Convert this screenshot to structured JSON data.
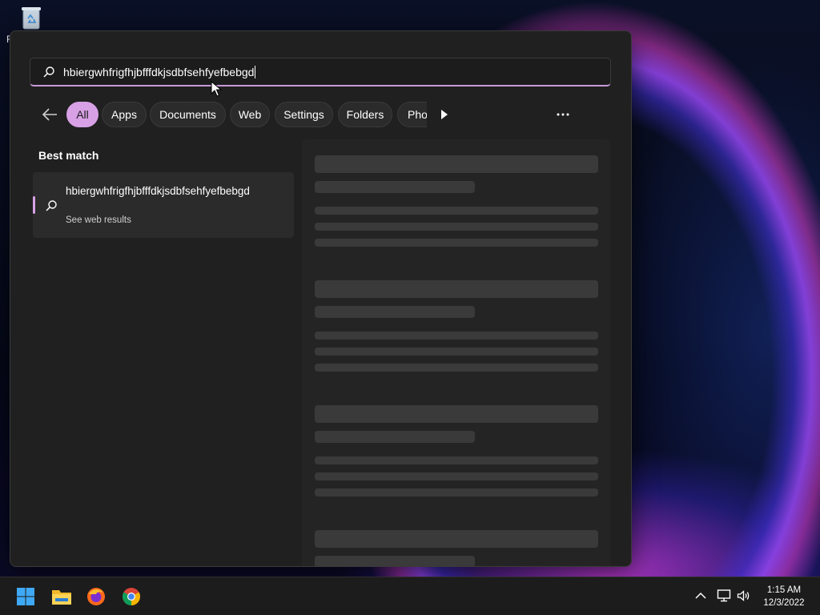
{
  "desktop": {
    "icon_label_sliver": "R"
  },
  "search": {
    "query": "hbiergwhfrigfhjbfffdkjsdbfsehfyefbebgd"
  },
  "filters": {
    "chips": [
      "All",
      "Apps",
      "Documents",
      "Web",
      "Settings",
      "Folders",
      "Phot"
    ],
    "active": "All"
  },
  "results": {
    "heading": "Best match",
    "best_match": {
      "title": "hbiergwhfrigfhjbfffdkjsdbfsehfyefbebgd",
      "subtitle": "See web results"
    }
  },
  "colors": {
    "accent": "#d8a1e6",
    "flyout_bg": "#202020",
    "taskbar_bg": "#1c1c1c"
  },
  "taskbar": {
    "apps": [
      "start-icon",
      "file-explorer-icon",
      "firefox-icon",
      "chrome-icon"
    ],
    "tray_icons": [
      "chevron-up-icon",
      "network-icon",
      "volume-icon"
    ],
    "time": "1:15 AM",
    "date": "12/3/2022"
  }
}
